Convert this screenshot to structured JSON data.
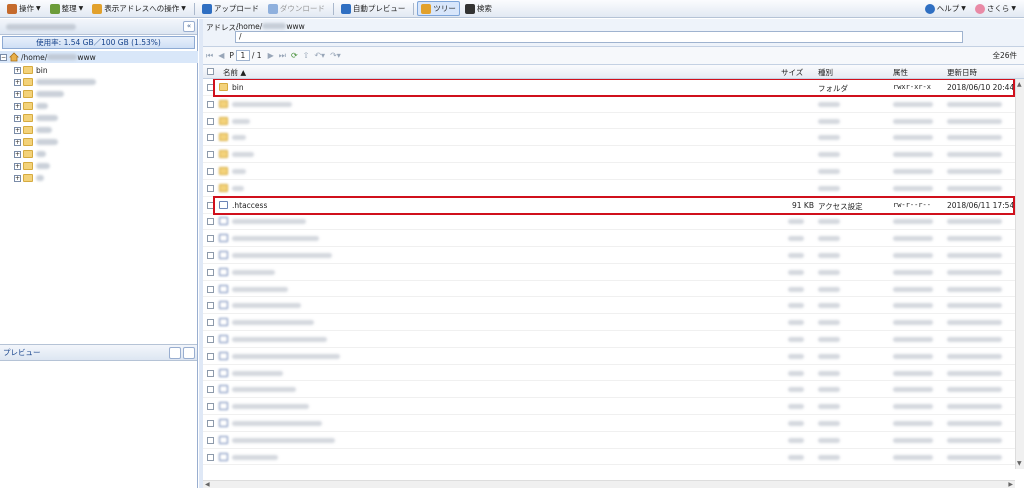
{
  "toolbar": {
    "items": [
      {
        "label": "操作",
        "icon": "operation-icon",
        "color": "#c56a2c",
        "caret": true
      },
      {
        "label": "整理",
        "icon": "organize-icon",
        "color": "#6c9c3a",
        "caret": true
      },
      {
        "label": "表示アドレスへの操作",
        "icon": "address-op-icon",
        "color": "#e2a12c",
        "caret": true
      },
      {
        "label": "アップロード",
        "icon": "upload-icon",
        "color": "#2f6fc2"
      },
      {
        "label": "ダウンロード",
        "icon": "download-icon",
        "color": "#8fb0dd",
        "disabled": true
      },
      {
        "label": "自動プレビュー",
        "icon": "preview-icon",
        "color": "#2f6fc2"
      },
      {
        "label": "ツリー",
        "icon": "tree-icon",
        "color": "#e2a12c",
        "active": true
      },
      {
        "label": "検索",
        "icon": "binoculars-icon",
        "color": "#333333"
      }
    ],
    "help": "ヘルプ",
    "user": "さくら"
  },
  "left": {
    "usage": "使用率: 1.54 GB／100 GB (1.53%)",
    "collapse": "«",
    "root_label": "/home/",
    "root_label_end": "www",
    "first_child": "bin",
    "preview_title": "プレビュー"
  },
  "right": {
    "address_label": "アドレス:",
    "address_path": "/home/",
    "address_path_end": "www",
    "address_input": "/",
    "page_label": "P",
    "page_value": "1",
    "page_total": "/ 1",
    "total": "全26件",
    "columns": {
      "name": "名前",
      "size": "サイズ",
      "type": "種別",
      "attr": "属性",
      "date": "更新日時"
    },
    "rows": [
      {
        "name": "bin",
        "icon": "folder",
        "size": "",
        "type": "フォルダ",
        "attr": "rwxr-xr-x",
        "date": "2018/06/10 20:44"
      },
      {
        "name": ".htaccess",
        "icon": "file",
        "size": "91 KB",
        "type": "アクセス設定",
        "attr": "rw-r--r--",
        "date": "2018/06/11 17:54"
      }
    ]
  },
  "colors": {
    "highlight": "#d0101c",
    "accent": "#15428b"
  }
}
